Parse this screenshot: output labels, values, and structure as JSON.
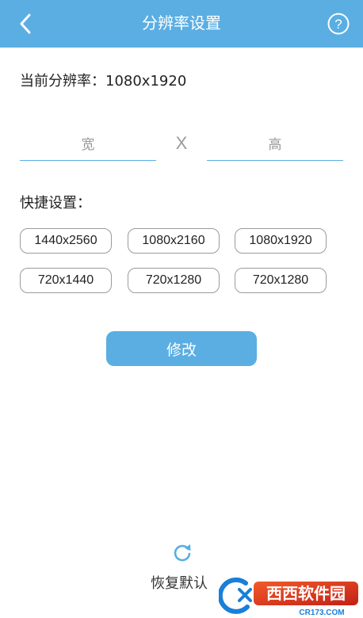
{
  "header": {
    "title": "分辨率设置",
    "back_icon": "chevron-left-icon",
    "help_icon": "question-circle-icon"
  },
  "current": {
    "text": "当前分辨率：1080x1920"
  },
  "inputs": {
    "width_placeholder": "宽",
    "separator": "X",
    "height_placeholder": "高"
  },
  "quick": {
    "label": "快捷设置：",
    "presets": [
      "1440x2560",
      "1080x2160",
      "1080x1920",
      "720x1440",
      "720x1280",
      "720x1280"
    ]
  },
  "modify_button": "修改",
  "reset": {
    "label": "恢复默认",
    "icon": "refresh-icon"
  },
  "watermark": {
    "brand": "西西软件园",
    "url": "CR173.COM"
  },
  "colors": {
    "accent": "#5aaee2",
    "border": "#9b9b9b"
  }
}
